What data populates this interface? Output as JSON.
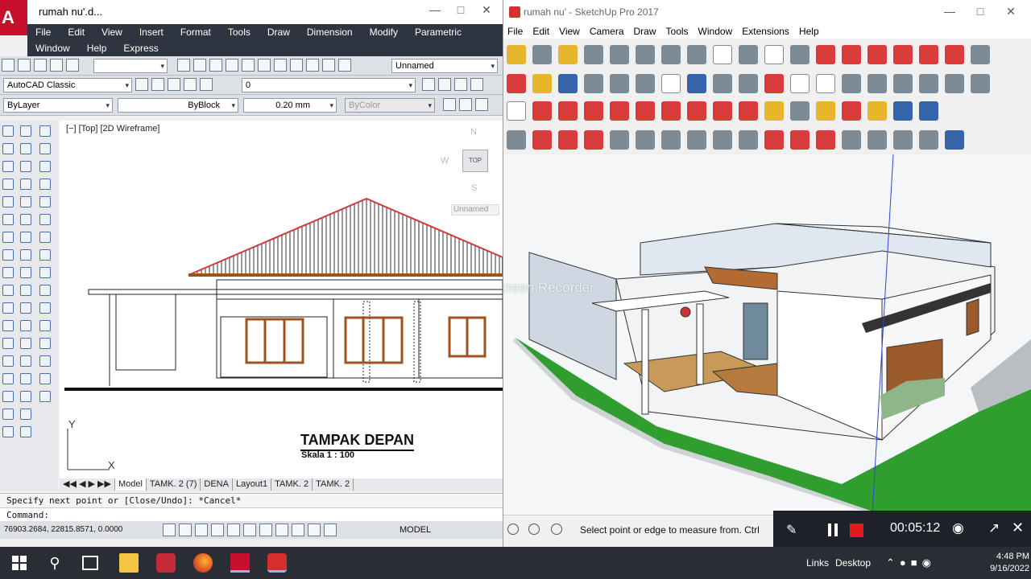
{
  "autocad": {
    "window_title": "rumah nu'.d...",
    "logo_letter": "A",
    "menu_row1": [
      "File",
      "Edit",
      "View",
      "Insert",
      "Format",
      "Tools",
      "Draw",
      "Dimension",
      "Modify",
      "Parametric"
    ],
    "menu_row2": [
      "Window",
      "Help",
      "Express"
    ],
    "view_combo": "Unnamed",
    "workspace": "AutoCAD Classic",
    "layer": "0",
    "color": "ByLayer",
    "linetype": "ByBlock",
    "lineweight": "0.20 mm",
    "plotstyle": "ByColor",
    "viewport_label": "[−] [Top] [2D Wireframe]",
    "viewcube_label": "TOP",
    "compass": {
      "n": "N",
      "w": "W",
      "s": "S"
    },
    "ucs_label": "Unnamed",
    "drawing_title": "TAMPAK DEPAN",
    "drawing_scale": "Skala 1 : 100",
    "tabs": [
      "Model",
      "TAMK. 2 (7)",
      "DENA",
      "Layout1",
      "TAMK. 2",
      "TAMK. 2"
    ],
    "active_tab": "Model",
    "command_history": "Specify next point or [Close/Undo]: *Cancel*",
    "command_prompt": "Command:",
    "coordinates": "76903.2684, 22815.8571, 0.0000",
    "status_model": "MODEL"
  },
  "sketchup": {
    "window_title": "rumah nu' - SketchUp Pro 2017",
    "menu": [
      "File",
      "Edit",
      "View",
      "Camera",
      "Draw",
      "Tools",
      "Window",
      "Extensions",
      "Help"
    ],
    "status_message": "Select point or edge to measure from.  Ctrl",
    "watermark": "Recorded with iTop Screen Recorder"
  },
  "recorder": {
    "elapsed": "00:05:12"
  },
  "taskbar": {
    "links_label": "Links",
    "desktop_label": "Desktop",
    "time": "4:48 PM",
    "date": "9/16/2022"
  },
  "colors": {
    "autocad_red": "#c8102e",
    "roof_red": "#d23a3a",
    "window_brown": "#a0521e",
    "lawn_green": "#2f9e2f",
    "recorder_stop": "#e11b1b"
  }
}
